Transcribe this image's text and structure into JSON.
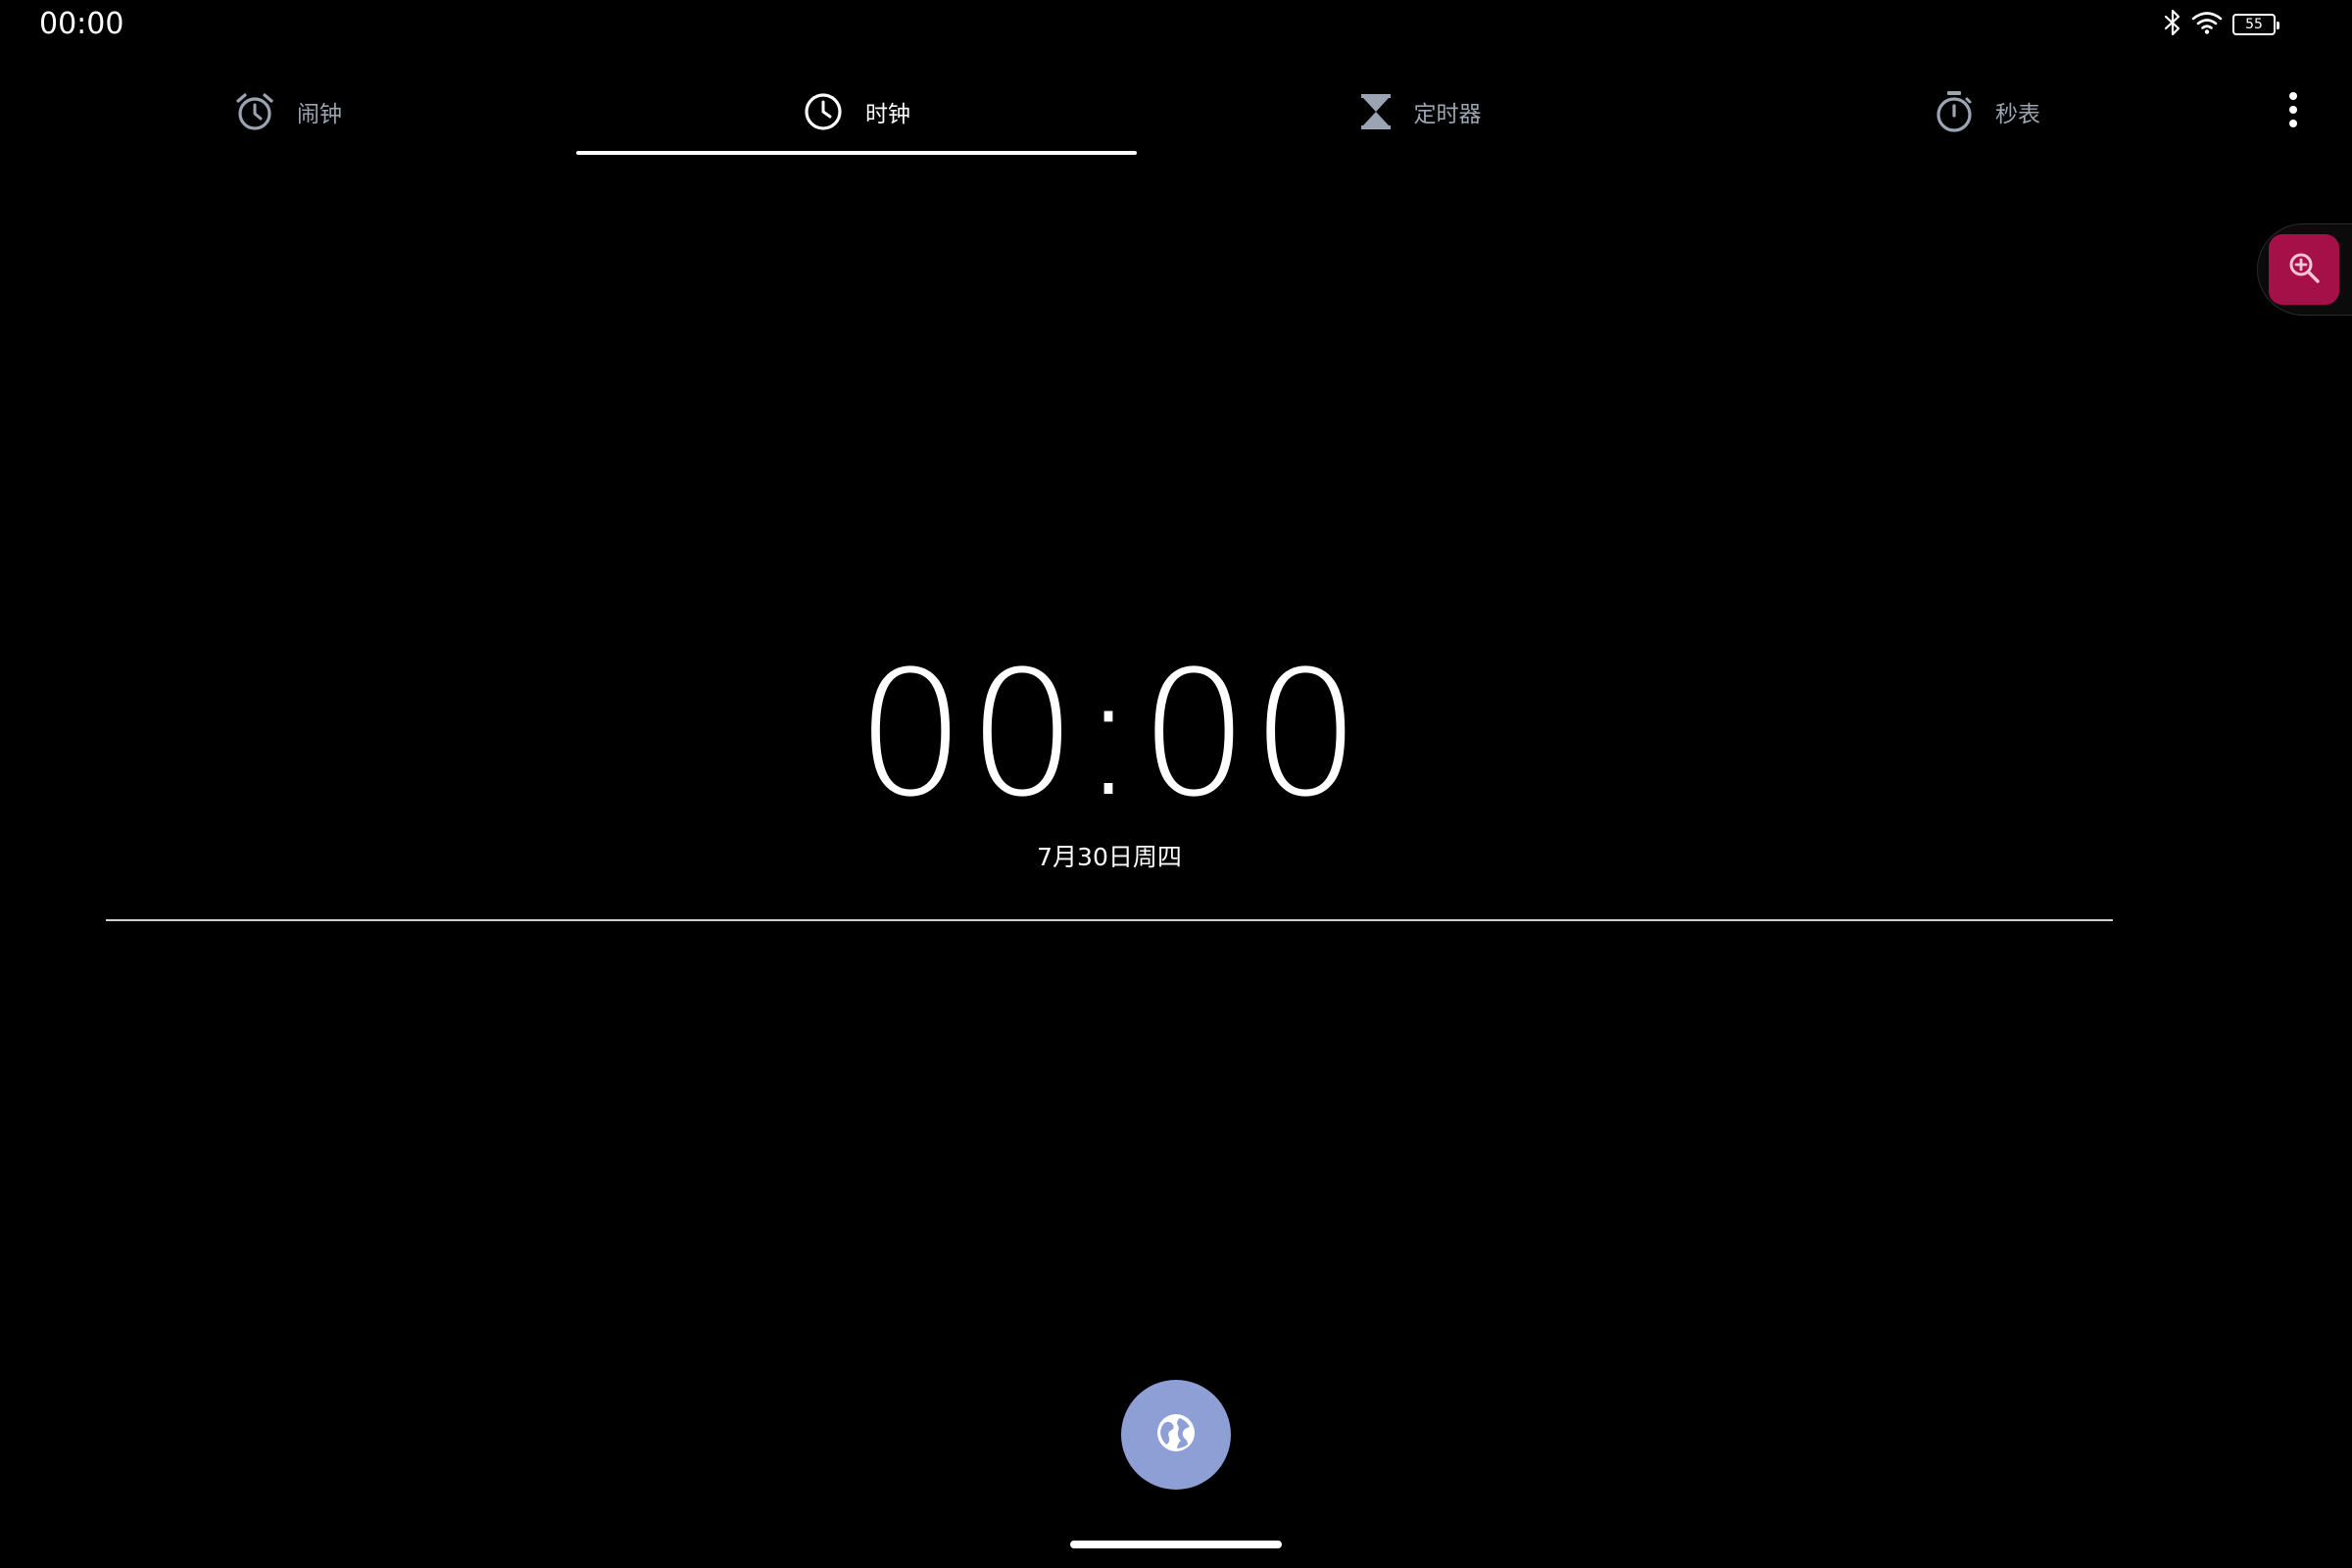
{
  "status_bar": {
    "time": "00:00",
    "battery_level": "55",
    "icons": [
      "bluetooth-icon",
      "wifi-icon",
      "battery-icon"
    ]
  },
  "tabs": [
    {
      "label": "闹钟",
      "icon": "alarm-icon",
      "active": false
    },
    {
      "label": "时钟",
      "icon": "clock-icon",
      "active": true
    },
    {
      "label": "定时器",
      "icon": "hourglass-icon",
      "active": false
    },
    {
      "label": "秒表",
      "icon": "stopwatch-icon",
      "active": false
    }
  ],
  "clock": {
    "time": "00:00",
    "date": "7月30日周四"
  },
  "fab": {
    "icon": "globe-icon"
  },
  "overflow_menu": {
    "icon": "more-vert-icon"
  },
  "floating_tool": {
    "icon": "zoom-in-icon",
    "color": "#a51049"
  },
  "colors": {
    "background": "#000000",
    "tab_inactive": "#9aa4b2",
    "tab_active": "#ffffff",
    "fab": "#8e9fd6"
  }
}
